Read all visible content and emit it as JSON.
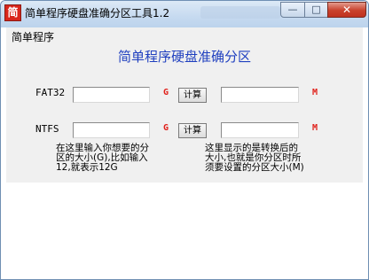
{
  "window": {
    "title": "简单程序硬盘准确分区工具1.2",
    "icon_char": "简",
    "controls": {
      "minimize": "—",
      "maximize": "□",
      "close": "✕"
    }
  },
  "menu": {
    "items": [
      "简单程序"
    ]
  },
  "main": {
    "heading": "简单程序硬盘准确分区",
    "rows": [
      {
        "label": "FAT32",
        "input_unit": "G",
        "button": "计算",
        "output_unit": "M"
      },
      {
        "label": "NTFS",
        "input_unit": "G",
        "button": "计算",
        "output_unit": "M"
      }
    ],
    "left_note": "在这里输入你想要的分\n区的大小(G),比如输入\n12,就表示12G",
    "right_note": "这里显示的是转换后的\n大小,也就是你分区时所\n须要设置的分区大小(M)"
  },
  "colors": {
    "heading": "#1f3fbf",
    "unit": "#e0201a",
    "client_bg": "#f0f0f0"
  }
}
